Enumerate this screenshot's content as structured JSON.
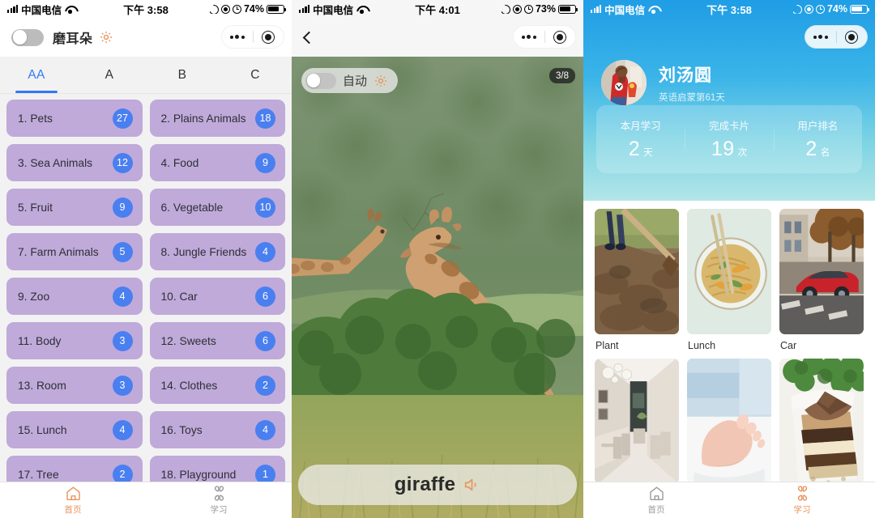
{
  "colors": {
    "accent_orange": "#e8945c",
    "accent_blue": "#3478f6",
    "card_purple": "#bfaada",
    "badge_blue": "#4a7ff0",
    "header_blue": "#1f9de6"
  },
  "screen1": {
    "status": {
      "carrier": "中国电信",
      "time": "下午 3:58",
      "battery": "74%"
    },
    "navbar": {
      "toggle_label": "磨耳朵",
      "toggle_on": false,
      "gear_icon": "gear-icon"
    },
    "capsule": {
      "more_icon": "more-dots-icon",
      "target_icon": "target-icon"
    },
    "tabs": [
      {
        "label": "AA",
        "active": true
      },
      {
        "label": "A",
        "active": false
      },
      {
        "label": "B",
        "active": false
      },
      {
        "label": "C",
        "active": false
      }
    ],
    "categories": [
      {
        "name": "1. Pets",
        "count": "27"
      },
      {
        "name": "2. Plains Animals",
        "count": "18"
      },
      {
        "name": "3. Sea Animals",
        "count": "12"
      },
      {
        "name": "4. Food",
        "count": "9"
      },
      {
        "name": "5. Fruit",
        "count": "9"
      },
      {
        "name": "6. Vegetable",
        "count": "10"
      },
      {
        "name": "7. Farm Animals",
        "count": "5"
      },
      {
        "name": "8. Jungle Friends",
        "count": "4"
      },
      {
        "name": "9. Zoo",
        "count": "4"
      },
      {
        "name": "10. Car",
        "count": "6"
      },
      {
        "name": "11. Body",
        "count": "3"
      },
      {
        "name": "12. Sweets",
        "count": "6"
      },
      {
        "name": "13. Room",
        "count": "3"
      },
      {
        "name": "14. Clothes",
        "count": "2"
      },
      {
        "name": "15. Lunch",
        "count": "4"
      },
      {
        "name": "16. Toys",
        "count": "4"
      },
      {
        "name": "17. Tree",
        "count": "2"
      },
      {
        "name": "18. Playground",
        "count": "1"
      }
    ],
    "tabbar": [
      {
        "label": "首页",
        "icon": "home-icon",
        "active": true
      },
      {
        "label": "学习",
        "icon": "clover-icon",
        "active": false
      }
    ]
  },
  "screen2": {
    "status": {
      "carrier": "中国电信",
      "time": "下午 4:01",
      "battery": "73%"
    },
    "navbar": {
      "back_icon": "back-chevron-icon"
    },
    "capsule": {
      "more_icon": "more-dots-icon",
      "target_icon": "target-icon"
    },
    "auto_pill": {
      "label": "自动",
      "toggle_on": false,
      "gear_icon": "gear-icon"
    },
    "counter": "3/8",
    "photo": {
      "alt": "two giraffes on green hillside"
    },
    "word_card": {
      "word": "giraffe",
      "speaker_icon": "speaker-icon"
    }
  },
  "screen3": {
    "status": {
      "carrier": "中国电信",
      "time": "下午 3:58",
      "battery": "74%"
    },
    "capsule": {
      "more_icon": "more-dots-icon",
      "target_icon": "target-icon"
    },
    "profile": {
      "name": "刘汤圆",
      "subtitle": "英语启蒙第61天",
      "avatar_icon": "avatar"
    },
    "stats": [
      {
        "label": "本月学习",
        "value": "2",
        "unit": "天"
      },
      {
        "label": "完成卡片",
        "value": "19",
        "unit": "次"
      },
      {
        "label": "用户排名",
        "value": "2",
        "unit": "名"
      }
    ],
    "gallery": [
      {
        "caption": "Plant",
        "alt": "hoe digging soil"
      },
      {
        "caption": "Lunch",
        "alt": "bowl of noodles with chopsticks"
      },
      {
        "caption": "Car",
        "alt": "red car parked on street"
      },
      {
        "caption": "",
        "alt": "bright interior room"
      },
      {
        "caption": "",
        "alt": "baby foot"
      },
      {
        "caption": "",
        "alt": "slice of chocolate cake"
      }
    ],
    "tabbar": [
      {
        "label": "首页",
        "icon": "home-icon",
        "active": false
      },
      {
        "label": "学习",
        "icon": "clover-icon",
        "active": true
      }
    ]
  }
}
